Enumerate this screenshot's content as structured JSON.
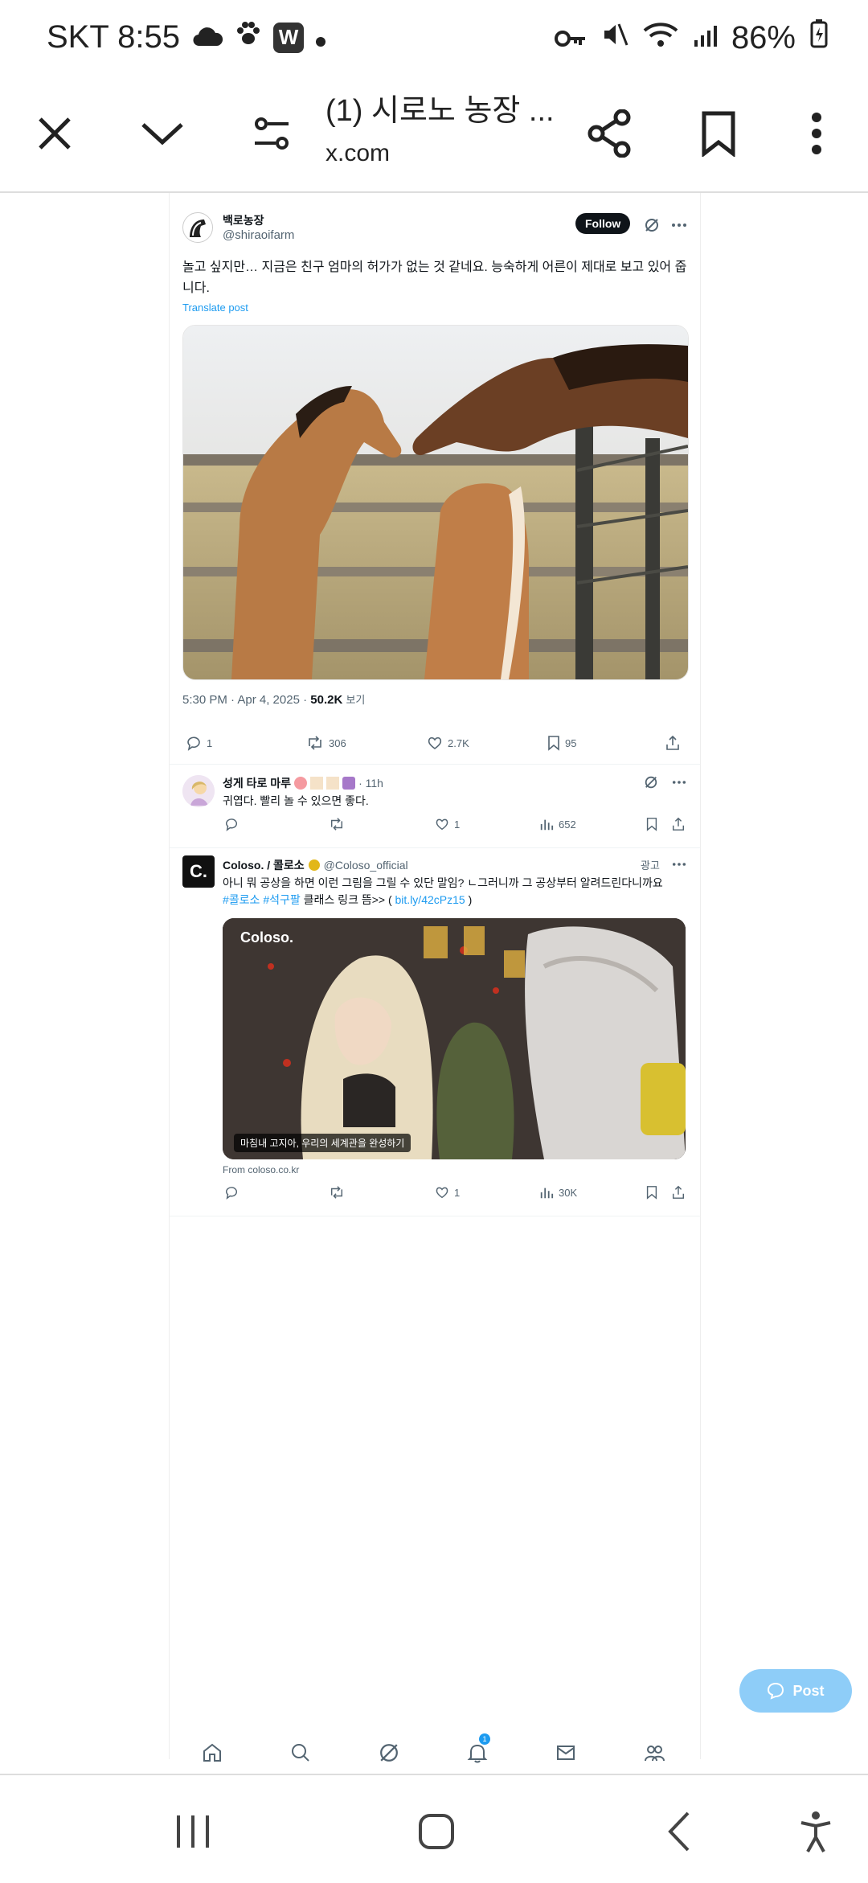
{
  "status": {
    "carrier_time": "SKT 8:55",
    "app_badge": "W",
    "battery": "86%"
  },
  "toolbar": {
    "title": "(1) 시로노 농장 ...",
    "url": "x.com"
  },
  "post": {
    "display_name": "백로농장",
    "handle": "@shiraoifarm",
    "follow_label": "Follow",
    "text": "놀고 싶지만… 지금은 친구 엄마의 허가가 없는 것 같네요. 능숙하게 어른이 제대로 보고 있어 줍니다.",
    "translate": "Translate post",
    "timestamp": "5:30 PM · Apr 4, 2025 ·",
    "views_count": "50.2K",
    "views_label": "보기",
    "replies": "1",
    "reposts": "306",
    "likes": "2.7K",
    "bookmarks": "95"
  },
  "reply": {
    "display_name": "성게 타로 마루",
    "time": "· 11h",
    "text": "귀엽다. 빨리 놀 수 있으면 좋다.",
    "likes": "1",
    "views": "652"
  },
  "ad": {
    "display_name": "Coloso. / 콜로소",
    "handle": "@Coloso_official",
    "ad_label": "광고",
    "text_line1": "아니 뭐 공상을 하면 이런 그림을 그릴 수 있단 말임? ㄴ그러니까 그 공상부터 알려드린다니까요",
    "hashtag1": "#콜로소",
    "hashtag2": "#석구팔",
    "text_mid": "클래스 링크 뜸>> (",
    "link": "bit.ly/42cPz15",
    "text_end": ")",
    "card_brand": "Coloso.",
    "card_caption": "마침내 고지아, 우리의 세계관을 완성하기",
    "card_source": "From coloso.co.kr",
    "likes": "1",
    "views": "30K"
  },
  "fab": {
    "label": "Post"
  },
  "bottom_nav": {
    "notif_count": "1"
  }
}
